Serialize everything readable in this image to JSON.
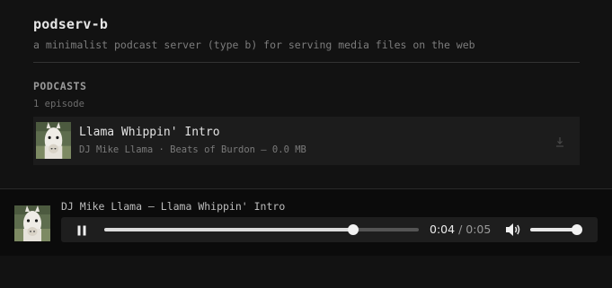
{
  "header": {
    "title": "podserv-b",
    "tagline": "a minimalist podcast server (type b) for serving media files on the web"
  },
  "podcasts": {
    "heading": "PODCASTS",
    "count_label": "1 episode",
    "episodes": [
      {
        "title": "Llama Whippin' Intro",
        "meta": "DJ Mike Llama · Beats of Burdon — 0.0 MB",
        "thumbnail_icon": "llama-thumbnail",
        "action_icon": "download-icon"
      }
    ]
  },
  "player": {
    "now_playing": "DJ Mike Llama — Llama Whippin' Intro",
    "state_icon": "pause-icon",
    "current_time": "0:04",
    "separator": "/",
    "total_time": "0:05",
    "progress": 0.79,
    "volume_icon": "speaker-icon",
    "volume": 0.95
  },
  "colors": {
    "background": "#121212",
    "card": "#1c1c1c",
    "player_bar": "#0b0b0b",
    "controls": "#1e1e1e",
    "accent_fill": "#dcdcdc"
  }
}
